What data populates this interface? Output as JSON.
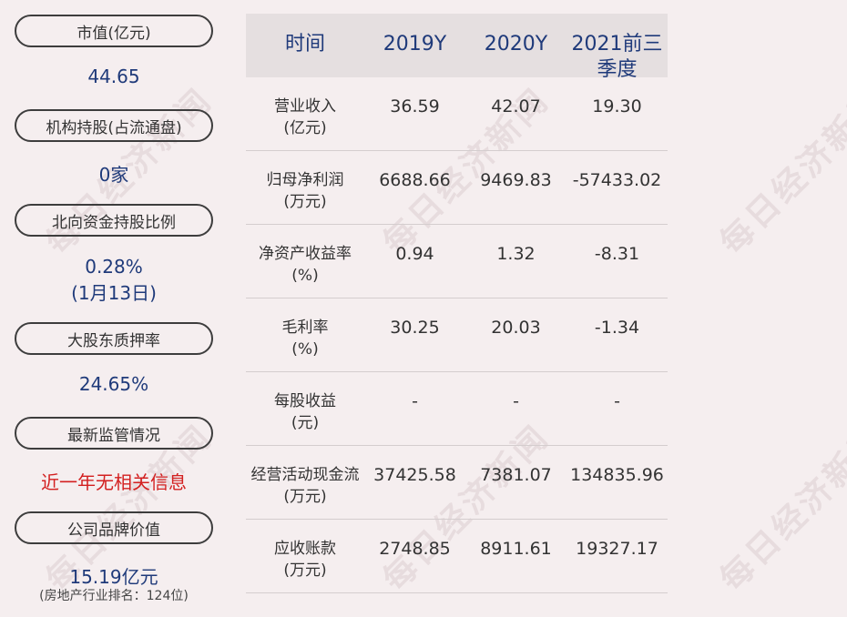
{
  "watermark": "每日经济新闻",
  "left": {
    "items": [
      {
        "label": "市值(亿元)",
        "value": "44.65"
      },
      {
        "label": "机构持股(占流通盘)",
        "value": "0家"
      },
      {
        "label": "北向资金持股比例",
        "value": "0.28%",
        "value2": "(1月13日)"
      },
      {
        "label": "大股东质押率",
        "value": "24.65%"
      },
      {
        "label": "最新监管情况",
        "value": "近一年无相关信息"
      },
      {
        "label": "公司品牌价值",
        "value": "15.19亿元",
        "note": "(房地产行业排名：124位)"
      }
    ]
  },
  "table": {
    "headers": [
      "时间",
      "2019Y",
      "2020Y",
      "2021前三季度"
    ],
    "rows": [
      {
        "label1": "营业收入",
        "label2": "(亿元)",
        "cells": [
          "36.59",
          "42.07",
          "19.30"
        ]
      },
      {
        "label1": "归母净利润",
        "label2": "(万元)",
        "cells": [
          "6688.66",
          "9469.83",
          "-57433.02"
        ]
      },
      {
        "label1": "净资产收益率",
        "label2": "(%)",
        "cells": [
          "0.94",
          "1.32",
          "-8.31"
        ]
      },
      {
        "label1": "毛利率",
        "label2": "(%)",
        "cells": [
          "30.25",
          "20.03",
          "-1.34"
        ]
      },
      {
        "label1": "每股收益",
        "label2": "(元)",
        "cells": [
          "-",
          "-",
          "-"
        ]
      },
      {
        "label1": "经营活动现金流",
        "label2": "(万元)",
        "cells": [
          "37425.58",
          "7381.07",
          "134835.96"
        ]
      },
      {
        "label1": "应收账款",
        "label2": "(万元)",
        "cells": [
          "2748.85",
          "8911.61",
          "19327.17"
        ]
      }
    ]
  }
}
